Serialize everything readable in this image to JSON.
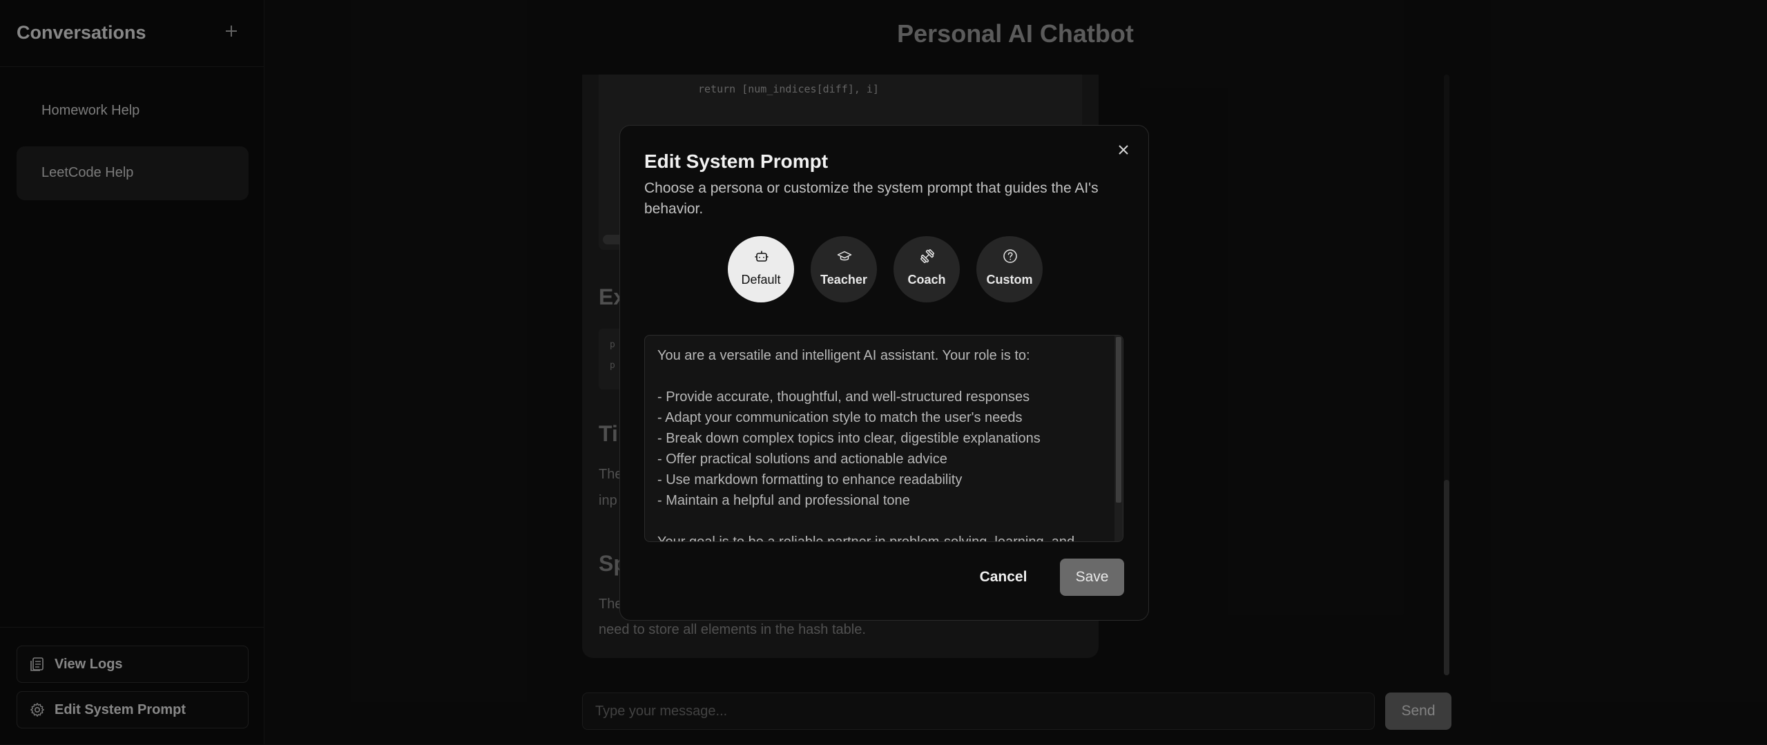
{
  "sidebar": {
    "title": "Conversations",
    "new_icon": "plus-icon",
    "items": [
      {
        "label": "Homework Help"
      },
      {
        "label": "LeetCode Help"
      }
    ],
    "footer": {
      "view_logs_label": "View Logs",
      "edit_prompt_label": "Edit System Prompt"
    }
  },
  "header": {
    "title": "Personal AI Chatbot"
  },
  "chat": {
    "code_line": "return [num_indices[diff], i]",
    "frag_ex": "Ex",
    "frag_ti": "Ti",
    "frag_sp": "Sp",
    "mini_code_1": "p",
    "mini_code_2": "p",
    "frag_the1": "The",
    "frag_inp": "inp",
    "frag_the2": "The",
    "frag_tail": "need to store all elements in the hash table."
  },
  "composer": {
    "placeholder": "Type your message...",
    "send_label": "Send"
  },
  "modal": {
    "title": "Edit System Prompt",
    "description": "Choose a persona or customize the system prompt that guides the AI's behavior.",
    "personas": [
      {
        "label": "Default",
        "icon": "bot-icon"
      },
      {
        "label": "Teacher",
        "icon": "graduation-cap-icon"
      },
      {
        "label": "Coach",
        "icon": "dumbbell-icon"
      },
      {
        "label": "Custom",
        "icon": "question-circle-icon"
      }
    ],
    "selected_persona": "Default",
    "prompt_text": "You are a versatile and intelligent AI assistant. Your role is to:\n\n- Provide accurate, thoughtful, and well-structured responses\n- Adapt your communication style to match the user's needs\n- Break down complex topics into clear, digestible explanations\n- Offer practical solutions and actionable advice\n- Use markdown formatting to enhance readability\n- Maintain a helpful and professional tone\n\nYour goal is to be a reliable partner in problem-solving, learning, and",
    "cancel_label": "Cancel",
    "save_label": "Save"
  },
  "colors": {
    "background": "#0f0f0f",
    "sidebar": "#0c0c0c",
    "modal": "#0c0c0c",
    "selected_persona": "#ececec",
    "save_button": "#6a6a6a"
  }
}
